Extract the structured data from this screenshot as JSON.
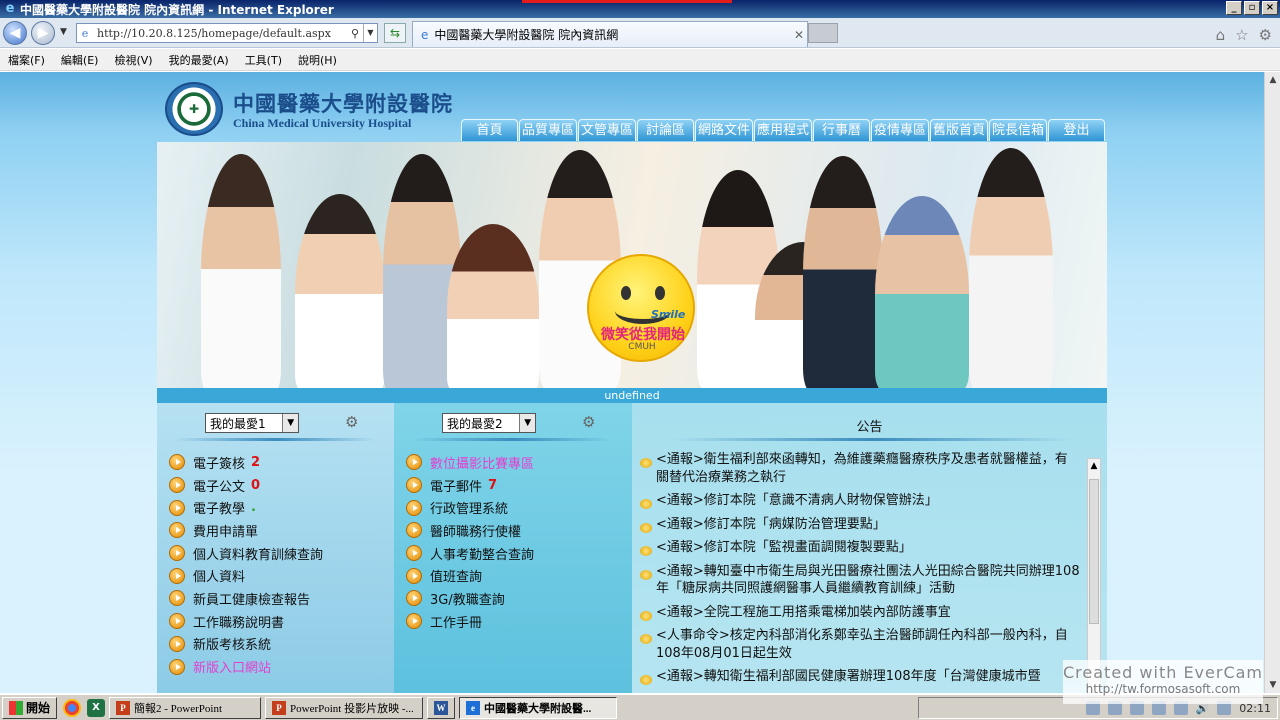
{
  "window": {
    "title": "中國醫藥大學附設醫院 院內資訊網 - Internet Explorer",
    "buttons": [
      "_",
      "▫",
      "×"
    ]
  },
  "address_bar": {
    "url": "http://10.20.8.125/homepage/default.aspx",
    "tab_title": "中國醫藥大學附設醫院 院內資訊網"
  },
  "menu": [
    "檔案(F)",
    "編輯(E)",
    "檢視(V)",
    "我的最愛(A)",
    "工具(T)",
    "說明(H)"
  ],
  "site": {
    "logo_cn": "中國醫藥大學附設醫院",
    "logo_en": "China Medical University Hospital",
    "nav": [
      "首頁",
      "品質專區",
      "文管專區",
      "討論區",
      "網路文件",
      "應用程式",
      "行事曆",
      "疫情專區",
      "舊版首頁",
      "院長信箱",
      "登出"
    ],
    "banner": {
      "smile_word": "Smile",
      "slogan": "微笑從我開始",
      "sub": "CMUH"
    },
    "undefined_label": "undefined"
  },
  "favorites1": {
    "selected": "我的最愛1",
    "items": [
      {
        "label": "電子簽核",
        "badge": "2"
      },
      {
        "label": "電子公文",
        "badge": "0"
      },
      {
        "label": "電子教學",
        "badge": "."
      },
      {
        "label": "費用申請單",
        "badge": ""
      },
      {
        "label": "個人資料教育訓練查詢",
        "badge": ""
      },
      {
        "label": "個人資料",
        "badge": ""
      },
      {
        "label": "新員工健康檢查報告",
        "badge": ""
      },
      {
        "label": "工作職務說明書",
        "badge": ""
      },
      {
        "label": "新版考核系統",
        "badge": ""
      },
      {
        "label": "新版入口網站",
        "badge": ""
      }
    ]
  },
  "favorites2": {
    "selected": "我的最愛2",
    "items": [
      {
        "label": "數位攝影比賽專區",
        "badge": ""
      },
      {
        "label": "電子郵件",
        "badge": "7"
      },
      {
        "label": "行政管理系統",
        "badge": ""
      },
      {
        "label": "醫師職務行使權",
        "badge": ""
      },
      {
        "label": "人事考勤整合查詢",
        "badge": ""
      },
      {
        "label": "值班查詢",
        "badge": ""
      },
      {
        "label": "3G/教職查詢",
        "badge": ""
      },
      {
        "label": "工作手冊",
        "badge": ""
      }
    ]
  },
  "announcements": {
    "title": "公告",
    "items": [
      "<通報>衛生福利部來函轉知，為維護藥癮醫療秩序及患者就醫權益，有關替代治療業務之執行",
      "<通報>修訂本院「意識不清病人財物保管辦法」",
      "<通報>修訂本院「病媒防治管理要點」",
      "<通報>修訂本院「監視畫面調閱複製要點」",
      "<通報>轉知臺中市衛生局與光田醫療社團法人光田綜合醫院共同辦理108年「糖尿病共同照護網醫事人員繼續教育訓練」活動",
      "<通報>全院工程施工用搭乘電梯加裝內部防護事宜",
      "<人事命令>核定內科部消化系鄭幸弘主治醫師調任內科部一般內科，自108年08月01日起生效",
      "<通報>轉知衛生福利部國民健康署辦理108年度「台灣健康城市暨"
    ]
  },
  "watermark": {
    "line1": "Created with EverCam",
    "line2": "http://tw.formosasoft.com"
  },
  "taskbar": {
    "start": "開始",
    "tasks": [
      {
        "label": "簡報2 - PowerPoint",
        "icon": "P",
        "color": "#c43e1c",
        "active": false
      },
      {
        "label": "PowerPoint 投影片放映 -...",
        "icon": "P",
        "color": "#c43e1c",
        "active": false
      },
      {
        "label": "",
        "icon": "W",
        "color": "#2b579a",
        "active": false
      },
      {
        "label": "中國醫藥大學附設醫...",
        "icon": "e",
        "color": "#1e6fd6",
        "active": true
      }
    ],
    "clock": "02:11"
  }
}
